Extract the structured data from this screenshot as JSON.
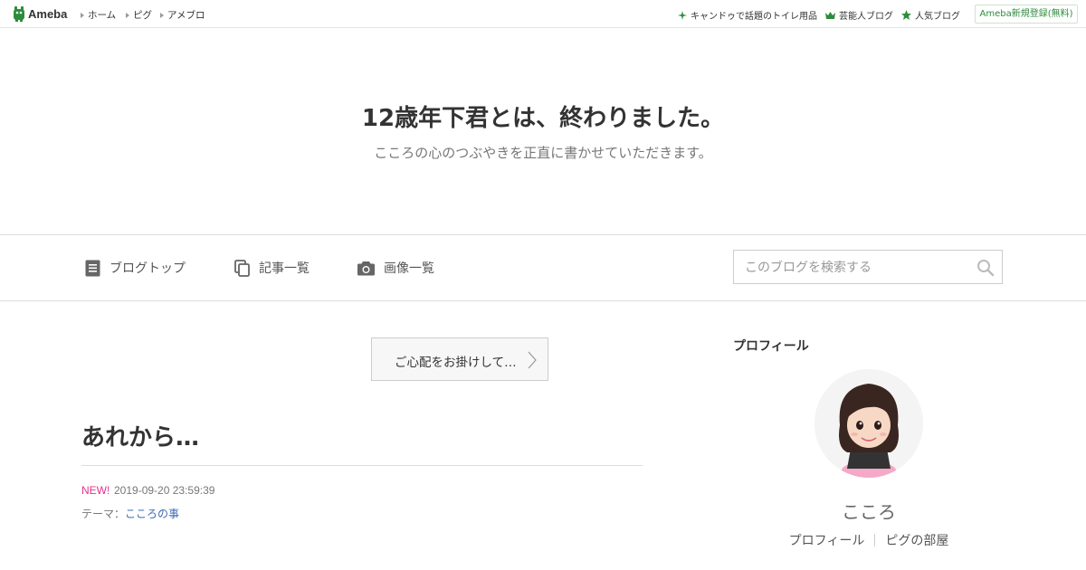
{
  "topbar": {
    "logo_text": "Ameba",
    "nav": [
      "ホーム",
      "ピグ",
      "アメブロ"
    ],
    "right_links": [
      {
        "label": "キャンドゥで話題のトイレ用品",
        "icon": "sparkle-icon"
      },
      {
        "label": "芸能人ブログ",
        "icon": "crown-icon"
      },
      {
        "label": "人気ブログ",
        "icon": "star-icon"
      }
    ],
    "signup_label": "Ameba新規登録(無料)"
  },
  "header": {
    "title": "12歳年下君とは、終わりました。",
    "description": "こころの心のつぶやきを正直に書かせていただきます。"
  },
  "nav": {
    "items": [
      {
        "label": "ブログトップ",
        "icon": "document-icon"
      },
      {
        "label": "記事一覧",
        "icon": "copy-icon"
      },
      {
        "label": "画像一覧",
        "icon": "camera-icon"
      }
    ],
    "search_placeholder": "このブログを検索する"
  },
  "prev_article": {
    "label": "ご心配をお掛けして…"
  },
  "article": {
    "title": "あれから…",
    "new_badge": "NEW!",
    "datetime": "2019-09-20 23:59:39",
    "theme_label": "テーマ：",
    "theme_value": "こころの事"
  },
  "sidebar": {
    "heading": "プロフィール",
    "name": "こころ",
    "links": [
      "プロフィール",
      "ピグの部屋"
    ]
  },
  "colors": {
    "accent_green": "#2d8c3c",
    "new_pink": "#e6308a",
    "link_blue": "#3b6cb5"
  }
}
